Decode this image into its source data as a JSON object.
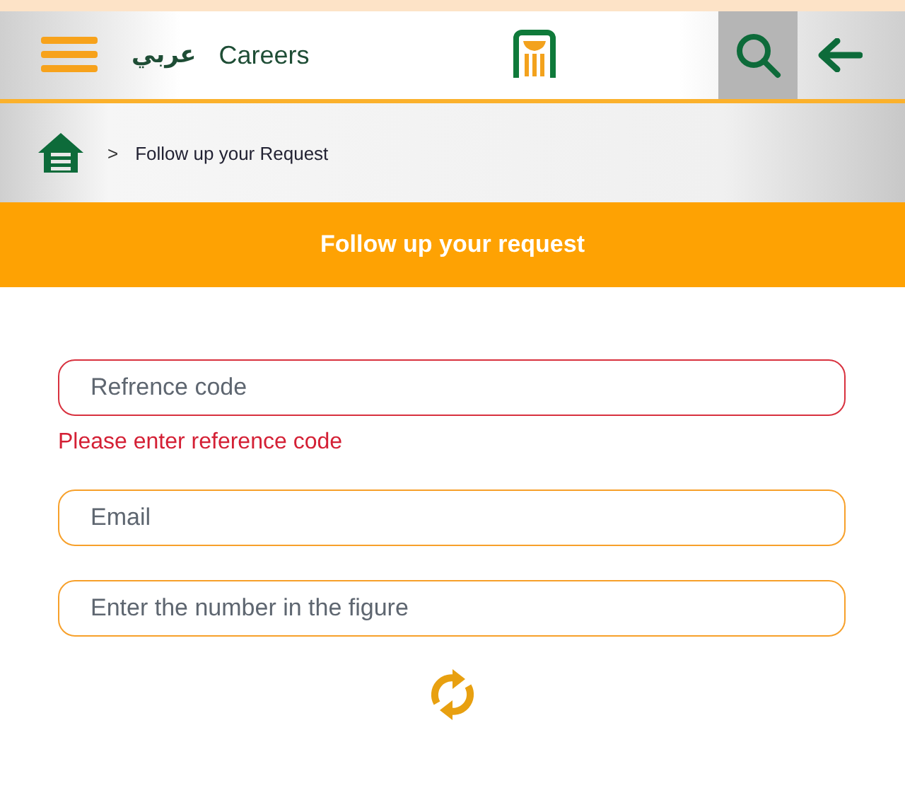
{
  "header": {
    "language_link": "عربي",
    "careers_link": "Careers"
  },
  "breadcrumb": {
    "separator": ">",
    "current": "Follow up your Request"
  },
  "banner": {
    "title": "Follow up your request"
  },
  "fields": [
    {
      "placeholder": "Refrence code",
      "invalid": true,
      "error": "Please enter reference code"
    },
    {
      "placeholder": "Email",
      "invalid": false
    },
    {
      "placeholder": "Enter the number in the figure",
      "invalid": false
    }
  ]
}
